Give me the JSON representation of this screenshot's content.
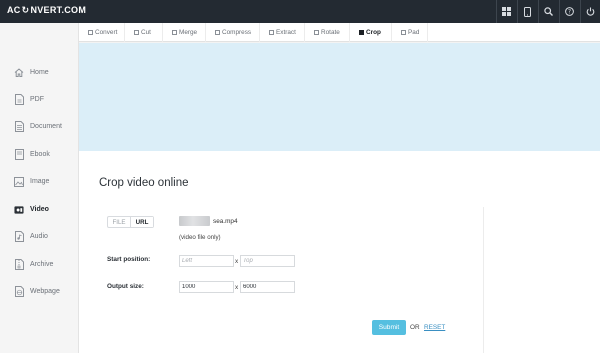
{
  "brand": {
    "logo_left": "AC",
    "logo_mark": "↻",
    "logo_right": "NVERT.COM"
  },
  "topbar": {
    "icons": [
      {
        "name": "grid-icon",
        "glyph": "▦"
      },
      {
        "name": "mobile-icon",
        "glyph": "▯"
      },
      {
        "name": "search-icon",
        "glyph": "⌕"
      },
      {
        "name": "help-icon",
        "glyph": "?"
      },
      {
        "name": "power-icon",
        "glyph": "⏻"
      }
    ]
  },
  "sidebar": {
    "items": [
      {
        "label": "Home",
        "icon": "home-icon"
      },
      {
        "label": "PDF",
        "icon": "pdf-icon"
      },
      {
        "label": "Document",
        "icon": "document-icon"
      },
      {
        "label": "Ebook",
        "icon": "ebook-icon"
      },
      {
        "label": "Image",
        "icon": "image-icon"
      },
      {
        "label": "Video",
        "icon": "video-icon",
        "active": true
      },
      {
        "label": "Audio",
        "icon": "audio-icon"
      },
      {
        "label": "Archive",
        "icon": "archive-icon"
      },
      {
        "label": "Webpage",
        "icon": "webpage-icon"
      }
    ]
  },
  "tabs": [
    {
      "label": "Convert"
    },
    {
      "label": "Cut"
    },
    {
      "label": "Merge"
    },
    {
      "label": "Compress"
    },
    {
      "label": "Extract"
    },
    {
      "label": "Rotate"
    },
    {
      "label": "Crop",
      "active": true
    },
    {
      "label": "Pad"
    }
  ],
  "main": {
    "title": "Crop video online",
    "source_toggle": {
      "file": "FILE",
      "url": "URL"
    },
    "file_name": "sea.mp4",
    "file_note": "(video file only)",
    "start_position": {
      "label": "Start position:",
      "left_placeholder": "Left",
      "top_placeholder": "Top",
      "separator": "x"
    },
    "output_size": {
      "label": "Output size:",
      "width_value": "1000",
      "height_value": "6000",
      "separator": "x"
    },
    "submit_label": "Submit",
    "or_label": "OR",
    "reset_label": "RESET"
  },
  "colors": {
    "topbar": "#232a32",
    "banner": "#dbeef8",
    "submit": "#55bfe0",
    "link": "#3a8fc2"
  }
}
